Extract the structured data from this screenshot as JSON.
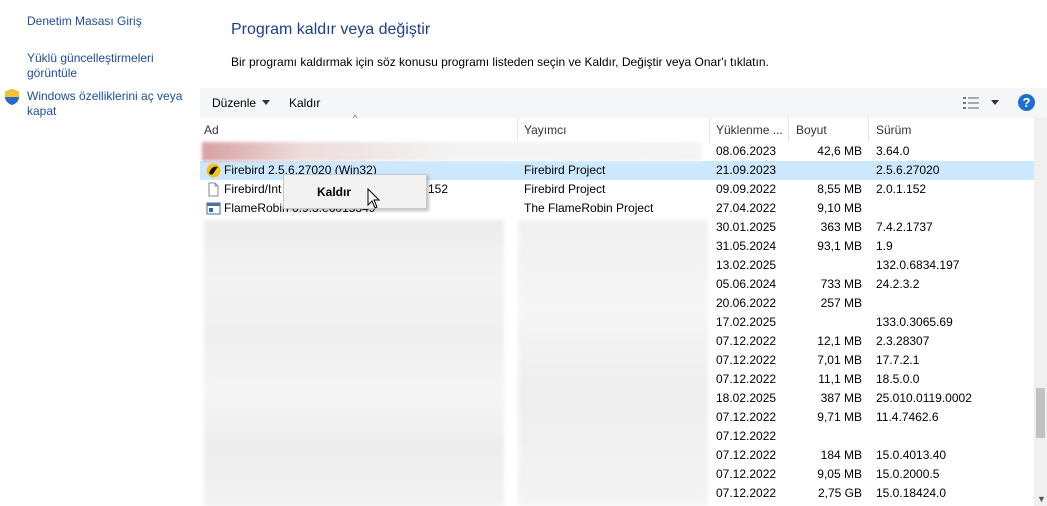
{
  "left_pane": {
    "links": [
      "Denetim Masası Giriş",
      "Yüklü güncelleştirmeleri görüntüle",
      "Windows özelliklerini aç veya kapat"
    ]
  },
  "header": {
    "title": "Program kaldır veya değiştir",
    "description": "Bir programı kaldırmak için söz konusu programı listeden seçin ve Kaldır, Değiştir veya Onar'ı tıklatın."
  },
  "toolbar": {
    "organize_label": "Düzenle",
    "uninstall_label": "Kaldır",
    "help_label": "?"
  },
  "columns": {
    "name": "Ad",
    "publisher": "Yayımcı",
    "installed_on": "Yüklenme ...",
    "size": "Boyut",
    "version": "Sürüm"
  },
  "rows": [
    {
      "name": "",
      "publisher": "",
      "date": "08.06.2023",
      "size": "42,6 MB",
      "version": "3.64.0"
    },
    {
      "name": "Firebird 2.5.6.27020 (Win32)",
      "publisher": "Firebird Project",
      "date": "21.09.2023",
      "size": "",
      "version": "2.5.6.27020"
    },
    {
      "name": "Firebird/Int",
      "name_tail": "152",
      "publisher": "Firebird Project",
      "date": "09.09.2022",
      "size": "8,55 MB",
      "version": "2.0.1.152"
    },
    {
      "name": "FlameRobin 0.9.3.e6015349",
      "publisher": "The FlameRobin Project",
      "date": "27.04.2022",
      "size": "9,10 MB",
      "version": ""
    },
    {
      "name": "",
      "publisher": "",
      "date": "30.01.2025",
      "size": "363 MB",
      "version": "7.4.2.1737"
    },
    {
      "name": "",
      "publisher": "",
      "date": "31.05.2024",
      "size": "93,1 MB",
      "version": "1.9"
    },
    {
      "name": "",
      "publisher": "",
      "date": "13.02.2025",
      "size": "",
      "version": "132.0.6834.197"
    },
    {
      "name": "",
      "publisher": "",
      "date": "05.06.2024",
      "size": "733 MB",
      "version": "24.2.3.2"
    },
    {
      "name": "",
      "publisher": "",
      "date": "20.06.2022",
      "size": "257 MB",
      "version": ""
    },
    {
      "name": "",
      "publisher": "",
      "date": "17.02.2025",
      "size": "",
      "version": "133.0.3065.69"
    },
    {
      "name": "",
      "publisher": "",
      "date": "07.12.2022",
      "size": "12,1 MB",
      "version": "2.3.28307"
    },
    {
      "name": "",
      "publisher": "",
      "date": "07.12.2022",
      "size": "7,01 MB",
      "version": "17.7.2.1"
    },
    {
      "name": "",
      "publisher": "",
      "date": "07.12.2022",
      "size": "11,1 MB",
      "version": "18.5.0.0"
    },
    {
      "name": "",
      "publisher": "",
      "date": "18.02.2025",
      "size": "387 MB",
      "version": "25.010.0119.0002"
    },
    {
      "name": "",
      "publisher": "",
      "date": "07.12.2022",
      "size": "9,71 MB",
      "version": "11.4.7462.6"
    },
    {
      "name": "",
      "publisher": "",
      "date": "07.12.2022",
      "size": "",
      "version": ""
    },
    {
      "name": "",
      "publisher": "",
      "date": "07.12.2022",
      "size": "184 MB",
      "version": "15.0.4013.40"
    },
    {
      "name": "",
      "publisher": "",
      "date": "07.12.2022",
      "size": "9,05 MB",
      "version": "15.0.2000.5"
    },
    {
      "name": "",
      "publisher": "",
      "date": "07.12.2022",
      "size": "2,75 GB",
      "version": "15.0.18424.0"
    }
  ],
  "context_menu": {
    "uninstall_label": "Kaldır"
  },
  "colors": {
    "link": "#1e4ea0",
    "title": "#1e3f8f",
    "selection": "#cce8ff",
    "help": "#1f6fd1"
  }
}
